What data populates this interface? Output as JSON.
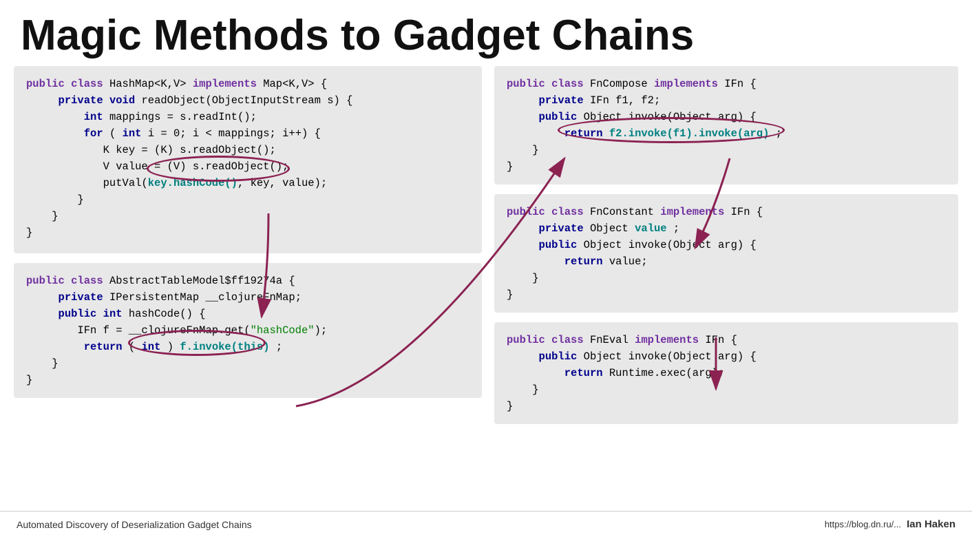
{
  "title": "Magic Methods to Gadget Chains",
  "footer": {
    "left": "Automated Discovery of Deserialization Gadget Chains",
    "right_url": "https://blog.dn.ru/...",
    "brand": "Ian Haken"
  },
  "left_top_code": {
    "lines": [
      {
        "parts": [
          {
            "t": "public class",
            "c": "kw-purple"
          },
          {
            "t": " HashMap<K,V> ",
            "c": ""
          },
          {
            "t": "implements",
            "c": "kw-purple"
          },
          {
            "t": " Map<K,V> {",
            "c": ""
          }
        ]
      },
      {
        "parts": [
          {
            "t": "    ",
            "c": ""
          },
          {
            "t": "private void",
            "c": "kw-blue"
          },
          {
            "t": " readObject(ObjectInputStream s) {",
            "c": ""
          }
        ]
      },
      {
        "parts": [
          {
            "t": "        ",
            "c": ""
          },
          {
            "t": "int",
            "c": "kw-blue"
          },
          {
            "t": " mappings = s.readInt();",
            "c": ""
          }
        ]
      },
      {
        "parts": [
          {
            "t": "        ",
            "c": ""
          },
          {
            "t": "for",
            "c": "kw-blue"
          },
          {
            "t": " (",
            "c": ""
          },
          {
            "t": "int",
            "c": "kw-blue"
          },
          {
            "t": " i = 0; i < mappings; i++) {",
            "c": ""
          }
        ]
      },
      {
        "parts": [
          {
            "t": "            K key = (K) s.readObject();",
            "c": ""
          }
        ]
      },
      {
        "parts": [
          {
            "t": "            V value = (V) s.readObject();",
            "c": ""
          }
        ]
      },
      {
        "parts": [
          {
            "t": "            putVal(",
            "c": ""
          },
          {
            "t": "key.hashCode()",
            "c": "kw-teal"
          },
          {
            "t": ", key, value);",
            "c": ""
          }
        ]
      },
      {
        "parts": [
          {
            "t": "        }",
            "c": ""
          }
        ]
      },
      {
        "parts": [
          {
            "t": "    }",
            "c": ""
          }
        ]
      },
      {
        "parts": [
          {
            "t": "}",
            "c": ""
          }
        ]
      }
    ]
  },
  "left_bottom_code": {
    "lines": [
      {
        "parts": [
          {
            "t": "public class",
            "c": "kw-purple"
          },
          {
            "t": " AbstractTableModel$ff19274a {",
            "c": ""
          }
        ]
      },
      {
        "parts": [
          {
            "t": "    ",
            "c": ""
          },
          {
            "t": "private",
            "c": "kw-blue"
          },
          {
            "t": " IPersistentMap __clojureFnMap;",
            "c": ""
          }
        ]
      },
      {
        "parts": [
          {
            "t": "    ",
            "c": ""
          },
          {
            "t": "public",
            "c": "kw-blue"
          },
          {
            "t": " ",
            "c": ""
          },
          {
            "t": "int",
            "c": "kw-blue"
          },
          {
            "t": " hashCode() {",
            "c": ""
          }
        ]
      },
      {
        "parts": [
          {
            "t": "        IFn f = __clojureFnMap.get(",
            "c": ""
          },
          {
            "t": "\"hashCode\"",
            "c": "str"
          },
          {
            "t": ");",
            "c": ""
          }
        ]
      },
      {
        "parts": [
          {
            "t": "        ",
            "c": ""
          },
          {
            "t": "return",
            "c": "kw-blue"
          },
          {
            "t": " (",
            "c": ""
          },
          {
            "t": "int",
            "c": "kw-blue"
          },
          {
            "t": " ) ",
            "c": ""
          },
          {
            "t": "f.invoke(this)",
            "c": "kw-teal"
          },
          {
            "t": ";",
            "c": ""
          }
        ]
      },
      {
        "parts": [
          {
            "t": "    }",
            "c": ""
          }
        ]
      },
      {
        "parts": [
          {
            "t": "}",
            "c": ""
          }
        ]
      }
    ]
  },
  "right_top_code": {
    "lines": [
      {
        "parts": [
          {
            "t": "public class",
            "c": "kw-purple"
          },
          {
            "t": " FnCompose ",
            "c": ""
          },
          {
            "t": "implements",
            "c": "kw-purple"
          },
          {
            "t": " IFn {",
            "c": ""
          }
        ]
      },
      {
        "parts": [
          {
            "t": "    ",
            "c": ""
          },
          {
            "t": "private",
            "c": "kw-blue"
          },
          {
            "t": " IFn f1, f2;",
            "c": ""
          }
        ]
      },
      {
        "parts": [
          {
            "t": "    ",
            "c": ""
          },
          {
            "t": "public",
            "c": "kw-blue"
          },
          {
            "t": " Object invoke(Object arg) {",
            "c": ""
          }
        ]
      },
      {
        "parts": [
          {
            "t": "        ",
            "c": ""
          },
          {
            "t": "return",
            "c": "kw-blue"
          },
          {
            "t": " ",
            "c": ""
          },
          {
            "t": "f2.invoke(f1).invoke(arg)",
            "c": "kw-teal"
          },
          {
            "t": ";",
            "c": ""
          }
        ]
      },
      {
        "parts": [
          {
            "t": "    }",
            "c": ""
          }
        ]
      },
      {
        "parts": [
          {
            "t": "}",
            "c": ""
          }
        ]
      }
    ]
  },
  "right_mid_code": {
    "lines": [
      {
        "parts": [
          {
            "t": "public class",
            "c": "kw-purple"
          },
          {
            "t": " FnConstant ",
            "c": ""
          },
          {
            "t": "implements",
            "c": "kw-purple"
          },
          {
            "t": " IFn {",
            "c": ""
          }
        ]
      },
      {
        "parts": [
          {
            "t": "    ",
            "c": ""
          },
          {
            "t": "private",
            "c": "kw-blue"
          },
          {
            "t": " Object ",
            "c": ""
          },
          {
            "t": "value",
            "c": "kw-teal"
          },
          {
            "t": ";",
            "c": ""
          }
        ]
      },
      {
        "parts": [
          {
            "t": "    ",
            "c": ""
          },
          {
            "t": "public",
            "c": "kw-blue"
          },
          {
            "t": " Object invoke(Object arg) {",
            "c": ""
          }
        ]
      },
      {
        "parts": [
          {
            "t": "        ",
            "c": ""
          },
          {
            "t": "return",
            "c": "kw-blue"
          },
          {
            "t": " value;",
            "c": ""
          }
        ]
      },
      {
        "parts": [
          {
            "t": "    }",
            "c": ""
          }
        ]
      },
      {
        "parts": [
          {
            "t": "}",
            "c": ""
          }
        ]
      }
    ]
  },
  "right_bottom_code": {
    "lines": [
      {
        "parts": [
          {
            "t": "public class",
            "c": "kw-purple"
          },
          {
            "t": " FnEval ",
            "c": ""
          },
          {
            "t": "implements",
            "c": "kw-purple"
          },
          {
            "t": " IFn {",
            "c": ""
          }
        ]
      },
      {
        "parts": [
          {
            "t": "    ",
            "c": ""
          },
          {
            "t": "public",
            "c": "kw-blue"
          },
          {
            "t": " Object invoke(Object arg) {",
            "c": ""
          }
        ]
      },
      {
        "parts": [
          {
            "t": "        ",
            "c": ""
          },
          {
            "t": "return",
            "c": "kw-blue"
          },
          {
            "t": " Runtime.exec(arg);",
            "c": ""
          }
        ]
      },
      {
        "parts": [
          {
            "t": "    }",
            "c": ""
          }
        ]
      },
      {
        "parts": [
          {
            "t": "}",
            "c": ""
          }
        ]
      }
    ]
  }
}
